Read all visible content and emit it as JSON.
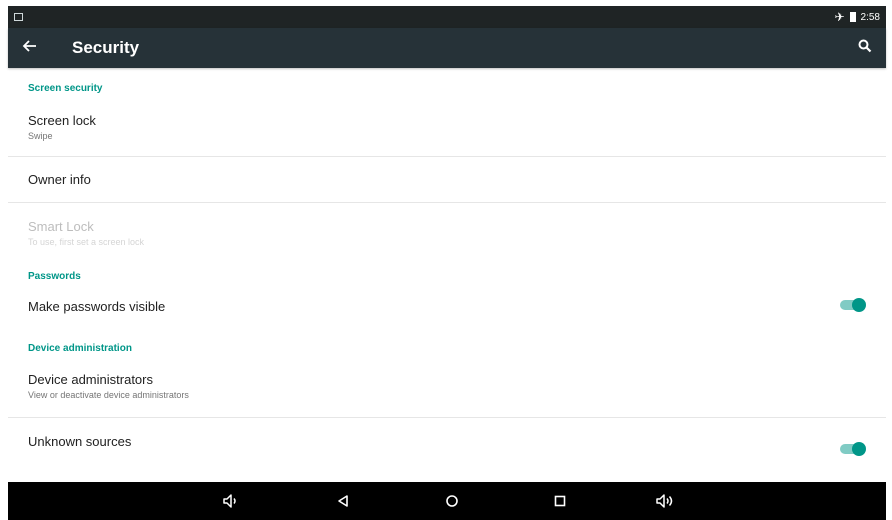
{
  "statusbar": {
    "time": "2:58"
  },
  "toolbar": {
    "title": "Security"
  },
  "sections": {
    "screen_security": {
      "header": "Screen security",
      "screen_lock": {
        "title": "Screen lock",
        "summary": "Swipe"
      },
      "owner_info": {
        "title": "Owner info"
      },
      "smart_lock": {
        "title": "Smart Lock",
        "summary": "To use, first set a screen lock"
      }
    },
    "passwords": {
      "header": "Passwords",
      "make_visible": {
        "title": "Make passwords visible",
        "enabled": true
      }
    },
    "device_admin": {
      "header": "Device administration",
      "device_admins": {
        "title": "Device administrators",
        "summary": "View or deactivate device administrators"
      },
      "unknown_sources": {
        "title": "Unknown sources",
        "enabled": true
      }
    }
  },
  "icons": {
    "back": "arrow-back-icon",
    "search": "search-icon",
    "airplane": "airplane-mode-icon",
    "battery": "battery-icon",
    "nav": [
      "volume-down-icon",
      "back-triangle-icon",
      "home-circle-icon",
      "recents-square-icon",
      "volume-up-icon"
    ]
  },
  "colors": {
    "accent": "#009688",
    "toolbar": "#263238",
    "statusbar": "#1f2425",
    "navbar": "#000000"
  }
}
